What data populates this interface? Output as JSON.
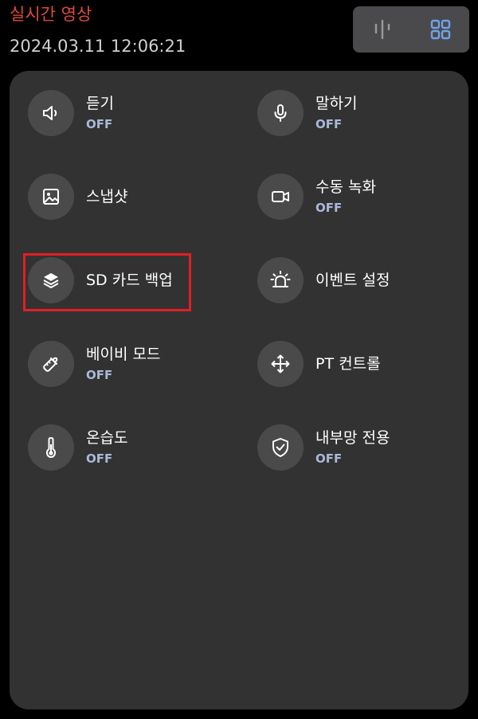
{
  "header": {
    "title": "실시간 영상",
    "datetime": "2024.03.11 12:06:21"
  },
  "view_toggle": {
    "left_icon": "audio-bars-icon",
    "right_icon": "grid-icon",
    "active": "grid",
    "active_color": "#6fa3e8"
  },
  "accent_color": "#e0483e",
  "state_color": "#aab8d8",
  "highlight_color": "#e31e24",
  "tiles": [
    {
      "label": "듣기",
      "state": "OFF",
      "icon": "speaker-icon"
    },
    {
      "label": "말하기",
      "state": "OFF",
      "icon": "microphone-icon"
    },
    {
      "label": "스냅샷",
      "state": "",
      "icon": "image-icon"
    },
    {
      "label": "수동 녹화",
      "state": "OFF",
      "icon": "video-camera-icon"
    },
    {
      "label": "SD 카드 백업",
      "state": "",
      "icon": "layers-icon",
      "highlighted": true
    },
    {
      "label": "이벤트 설정",
      "state": "",
      "icon": "alarm-light-icon"
    },
    {
      "label": "베이비 모드",
      "state": "OFF",
      "icon": "baby-bottle-icon"
    },
    {
      "label": "PT 컨트롤",
      "state": "",
      "icon": "move-arrows-icon"
    },
    {
      "label": "온습도",
      "state": "OFF",
      "icon": "thermometer-icon"
    },
    {
      "label": "내부망 전용",
      "state": "OFF",
      "icon": "shield-check-icon"
    }
  ]
}
